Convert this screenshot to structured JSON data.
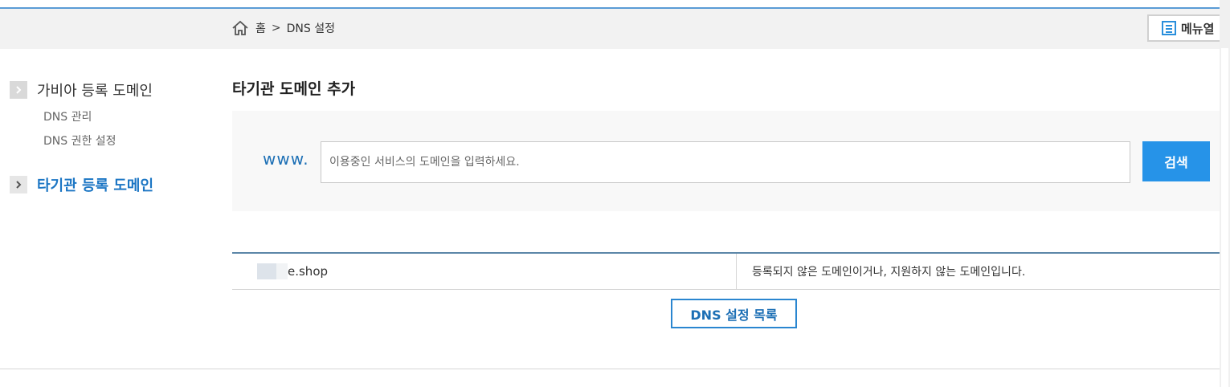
{
  "breadcrumb": {
    "home": "홈",
    "separator": ">",
    "current": "DNS 설정"
  },
  "menu_button": {
    "label": "메뉴열"
  },
  "sidebar": {
    "groups": [
      {
        "title": "가비아 등록 도메인",
        "active": false,
        "items": [
          {
            "label": "DNS 관리"
          },
          {
            "label": "DNS 권한 설정"
          }
        ]
      },
      {
        "title": "타기관 등록 도메인",
        "active": true,
        "items": []
      }
    ]
  },
  "main": {
    "title": "타기관 도메인 추가",
    "search": {
      "prefix": "www.",
      "placeholder": "이용중인 서비스의 도메인을 입력하세요.",
      "value": "",
      "button_label": "검색"
    },
    "result": {
      "domain": "e.shop",
      "message": "등록되지 않은 도메인이거나, 지원하지 않는 도메인입니다."
    },
    "dns_list_button": "DNS 설정 목록"
  },
  "colors": {
    "accent": "#1c76c4",
    "button": "#2693e8",
    "top_line": "#5a9bd5"
  }
}
